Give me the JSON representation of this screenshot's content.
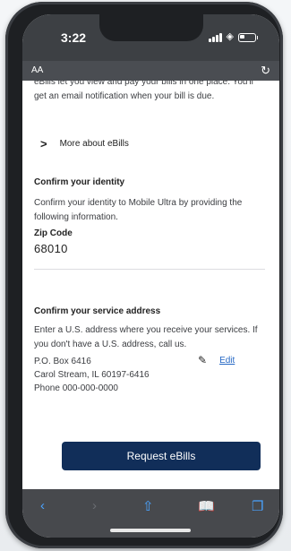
{
  "status": {
    "time": "3:22"
  },
  "browser": {
    "aa_label": "AA",
    "reload_icon": "reload-icon"
  },
  "page": {
    "intro": "eBills let you view and pay your bills in one place. You'll get an email notification when your bill is due.",
    "more_link": "More about eBills",
    "identity": {
      "heading": "Confirm your identity",
      "desc": "Confirm your identity to Mobile Ultra by providing the following information."
    },
    "zip": {
      "label": "Zip Code",
      "value": "68010"
    },
    "address": {
      "heading": "Confirm your service address",
      "desc": "Enter a U.S. address where you receive your services. If you don't have a U.S. address, call us.",
      "line1": "P.O. Box 6416",
      "line2": "Carol Stream, IL 60197-6416",
      "phone": "Phone 000-000-0000",
      "edit_label": "Edit"
    },
    "cta_label": "Request eBills"
  },
  "toolbar": [
    "back-icon",
    "forward-icon",
    "share-icon",
    "bookmarks-icon",
    "tabs-icon"
  ],
  "colors": {
    "cta": "#112e59",
    "link": "#2467c4",
    "toolbar_icon": "#4aa3ff"
  }
}
